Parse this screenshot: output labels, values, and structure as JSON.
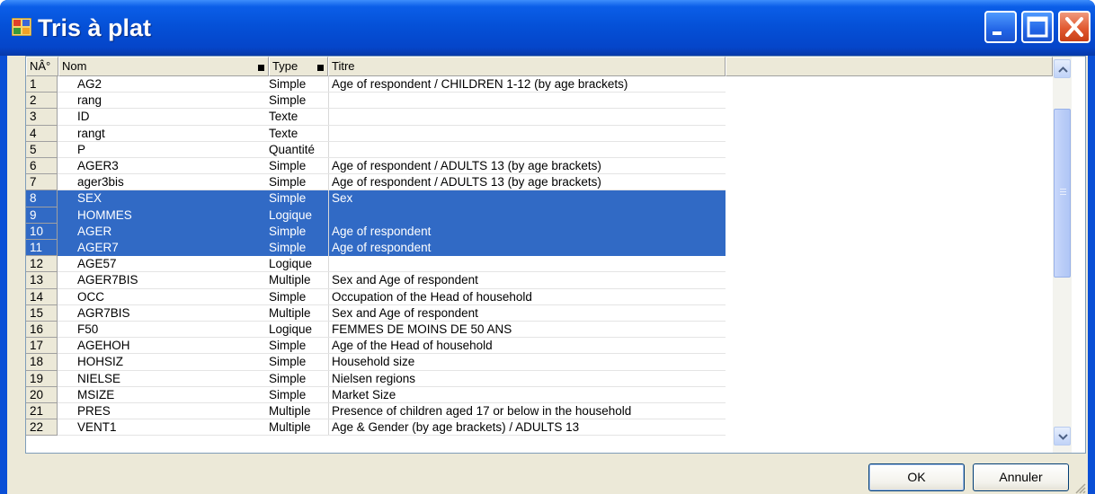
{
  "window": {
    "title": "Tris à plat"
  },
  "grid": {
    "headers": {
      "num": "NÂ°",
      "nom": "Nom",
      "type": "Type",
      "titre": "Titre"
    },
    "rows": [
      {
        "num": "1",
        "nom": "AG2",
        "type": "Simple",
        "titre": "Age of respondent / CHILDREN 1-12 (by age brackets)",
        "selected": false
      },
      {
        "num": "2",
        "nom": "rang",
        "type": "Simple",
        "titre": "",
        "selected": false
      },
      {
        "num": "3",
        "nom": "ID",
        "type": "Texte",
        "titre": "",
        "selected": false
      },
      {
        "num": "4",
        "nom": "rangt",
        "type": "Texte",
        "titre": "",
        "selected": false
      },
      {
        "num": "5",
        "nom": "P",
        "type": "Quantité",
        "titre": "",
        "selected": false
      },
      {
        "num": "6",
        "nom": "AGER3",
        "type": "Simple",
        "titre": "Age of respondent / ADULTS 13 (by age brackets)",
        "selected": false
      },
      {
        "num": "7",
        "nom": "ager3bis",
        "type": "Simple",
        "titre": "Age of respondent / ADULTS 13 (by age brackets)",
        "selected": false
      },
      {
        "num": "8",
        "nom": "SEX",
        "type": "Simple",
        "titre": "Sex",
        "selected": true
      },
      {
        "num": "9",
        "nom": "HOMMES",
        "type": "Logique",
        "titre": "",
        "selected": true
      },
      {
        "num": "10",
        "nom": "AGER",
        "type": "Simple",
        "titre": "Age of respondent",
        "selected": true
      },
      {
        "num": "11",
        "nom": "AGER7",
        "type": "Simple",
        "titre": "Age of respondent",
        "selected": true
      },
      {
        "num": "12",
        "nom": "AGE57",
        "type": "Logique",
        "titre": "",
        "selected": false
      },
      {
        "num": "13",
        "nom": "AGER7BIS",
        "type": "Multiple",
        "titre": "Sex and Age of respondent",
        "selected": false
      },
      {
        "num": "14",
        "nom": "OCC",
        "type": "Simple",
        "titre": "Occupation of the Head of household",
        "selected": false
      },
      {
        "num": "15",
        "nom": "AGR7BIS",
        "type": "Multiple",
        "titre": "Sex and Age of respondent",
        "selected": false
      },
      {
        "num": "16",
        "nom": "F50",
        "type": "Logique",
        "titre": "FEMMES DE MOINS DE 50 ANS",
        "selected": false
      },
      {
        "num": "17",
        "nom": "AGEHOH",
        "type": "Simple",
        "titre": "Age of the Head of household",
        "selected": false
      },
      {
        "num": "18",
        "nom": "HOHSIZ",
        "type": "Simple",
        "titre": "Household size",
        "selected": false
      },
      {
        "num": "19",
        "nom": "NIELSE",
        "type": "Simple",
        "titre": "Nielsen regions",
        "selected": false
      },
      {
        "num": "20",
        "nom": "MSIZE",
        "type": "Simple",
        "titre": "Market Size",
        "selected": false
      },
      {
        "num": "21",
        "nom": "PRES",
        "type": "Multiple",
        "titre": "Presence of children aged 17 or below in the household",
        "selected": false
      },
      {
        "num": "22",
        "nom": "VENT1",
        "type": "Multiple",
        "titre": "Age & Gender (by age brackets) / ADULTS 13",
        "selected": false
      }
    ]
  },
  "buttons": {
    "ok": "OK",
    "cancel": "Annuler"
  },
  "colors": {
    "titlebar": "#0551d8",
    "selection": "#316ac5",
    "dialog_face": "#ece9d8"
  }
}
